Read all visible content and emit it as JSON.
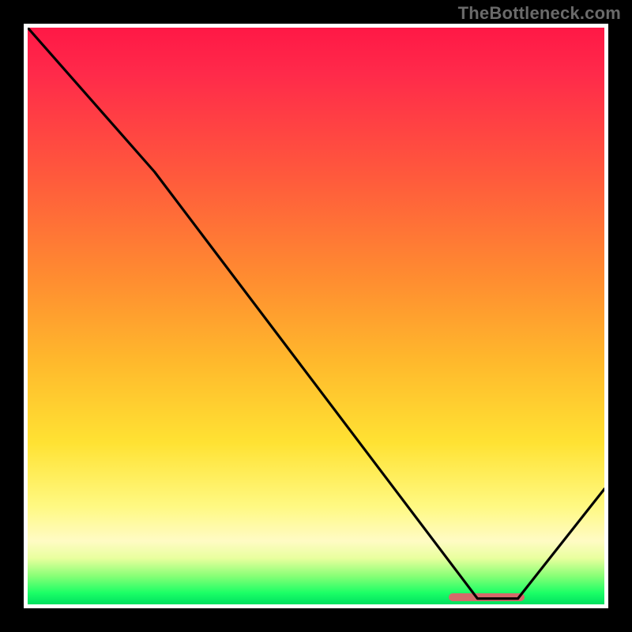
{
  "watermark": "TheBottleneck.com",
  "chart_data": {
    "type": "line",
    "title": "",
    "xlabel": "",
    "ylabel": "",
    "xlim": [
      0,
      100
    ],
    "ylim": [
      0,
      100
    ],
    "grid": false,
    "series": [
      {
        "name": "bottleneck-curve",
        "x": [
          0,
          22,
          78,
          85,
          100
        ],
        "y": [
          100,
          75,
          1,
          1,
          20
        ]
      }
    ],
    "annotations": [
      {
        "name": "optimal-range",
        "x_start": 73,
        "x_end": 86,
        "y": 1
      }
    ],
    "background": "vertical-gradient red→green",
    "colors": {
      "curve": "#000000",
      "frame": "#ffffff",
      "optimal_mark": "#d46a6a"
    }
  }
}
